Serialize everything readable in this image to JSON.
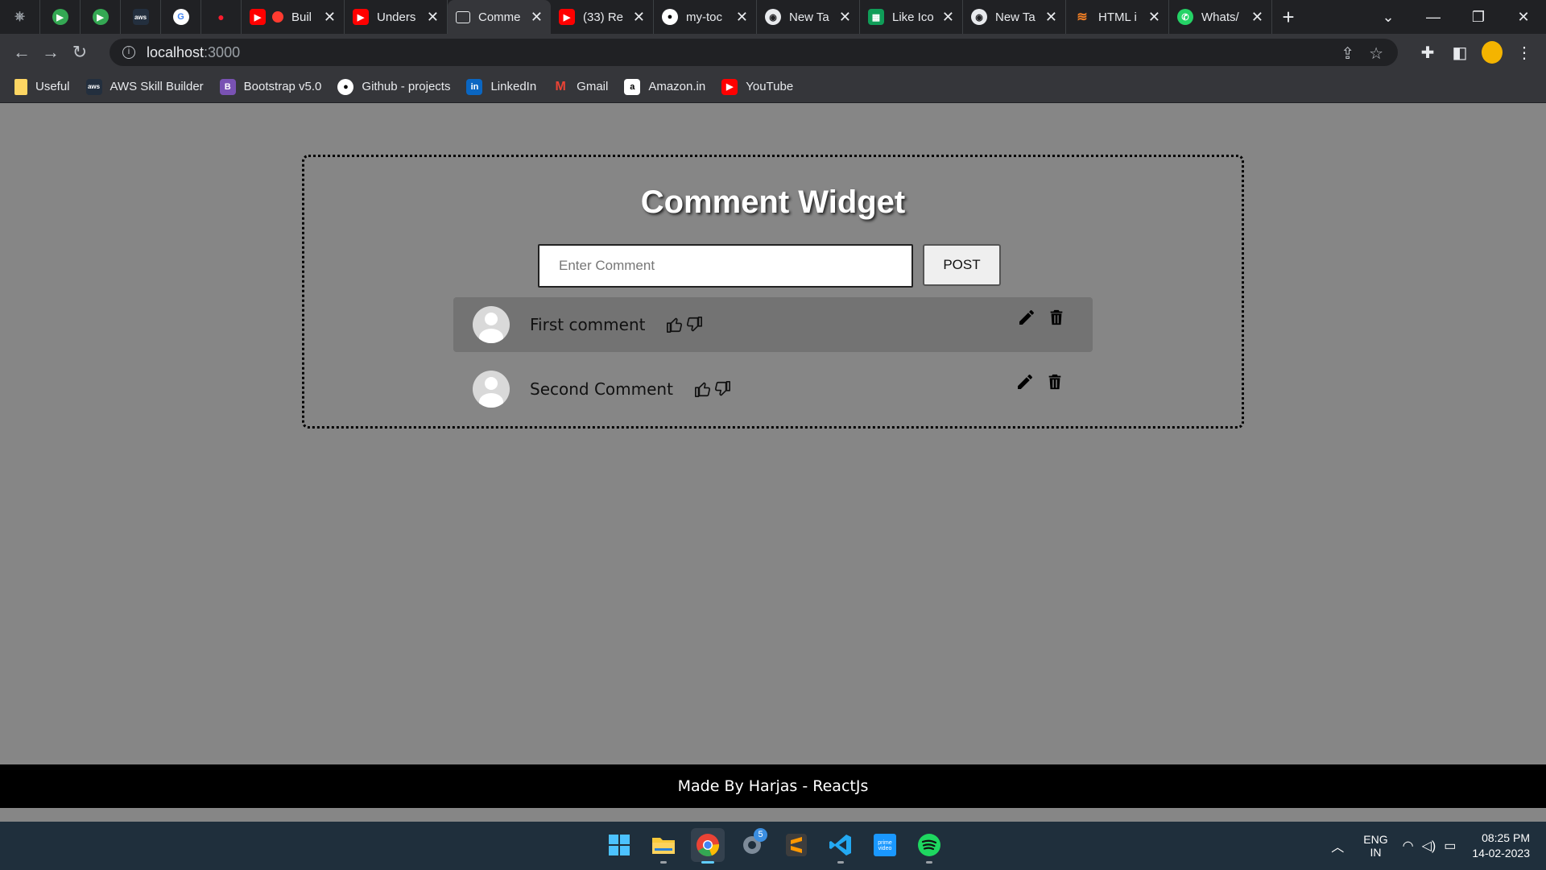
{
  "browser": {
    "tabs": [
      {
        "title": "Buil",
        "favicon": "youtube-icon",
        "active": false
      },
      {
        "title": "Unders",
        "favicon": "youtube-icon",
        "active": false
      },
      {
        "title": "Comme",
        "favicon": "comment-icon",
        "active": true
      },
      {
        "title": "(33) Re",
        "favicon": "youtube-icon",
        "active": false
      },
      {
        "title": "my-toc",
        "favicon": "github-icon",
        "active": false
      },
      {
        "title": "New Ta",
        "favicon": "chrome-icon",
        "active": false
      },
      {
        "title": "Like Ico",
        "favicon": "sheets-icon",
        "active": false
      },
      {
        "title": "New Ta",
        "favicon": "chrome-icon",
        "active": false
      },
      {
        "title": "HTML i",
        "favicon": "html-icon",
        "active": false
      },
      {
        "title": "Whats/",
        "favicon": "whatsapp-icon",
        "active": false
      }
    ],
    "url_host": "localhost",
    "url_port": ":3000",
    "bookmarks": [
      {
        "label": "Useful",
        "icon": "folder-icon"
      },
      {
        "label": "AWS Skill Builder",
        "icon": "aws-icon"
      },
      {
        "label": "Bootstrap v5.0",
        "icon": "bootstrap-icon"
      },
      {
        "label": "Github - projects",
        "icon": "github-icon"
      },
      {
        "label": "LinkedIn",
        "icon": "linkedin-icon"
      },
      {
        "label": "Gmail",
        "icon": "gmail-icon"
      },
      {
        "label": "Amazon.in",
        "icon": "amazon-icon"
      },
      {
        "label": "YouTube",
        "icon": "youtube-icon"
      }
    ]
  },
  "widget": {
    "title": "Comment Widget",
    "input_placeholder": "Enter Comment",
    "input_value": "",
    "post_label": "POST",
    "comments": [
      {
        "text": "First comment",
        "highlighted": true
      },
      {
        "text": "Second Comment",
        "highlighted": false
      }
    ]
  },
  "footer": {
    "text": "Made By Harjas - ReactJs"
  },
  "taskbar": {
    "apps": [
      "windows-start-icon",
      "file-explorer-icon",
      "chrome-icon",
      "settings-icon",
      "sublime-text-icon",
      "vscode-icon",
      "prime-video-icon",
      "spotify-icon"
    ],
    "notification_badge": "5",
    "lang_line1": "ENG",
    "lang_line2": "IN",
    "time": "08:25 PM",
    "date": "14-02-2023"
  },
  "colors": {
    "page_bg": "#868686",
    "highlight_row": "#737373",
    "footer_bg": "#000000",
    "chrome_dark": "#202124",
    "chrome_toolbar": "#35363a"
  }
}
